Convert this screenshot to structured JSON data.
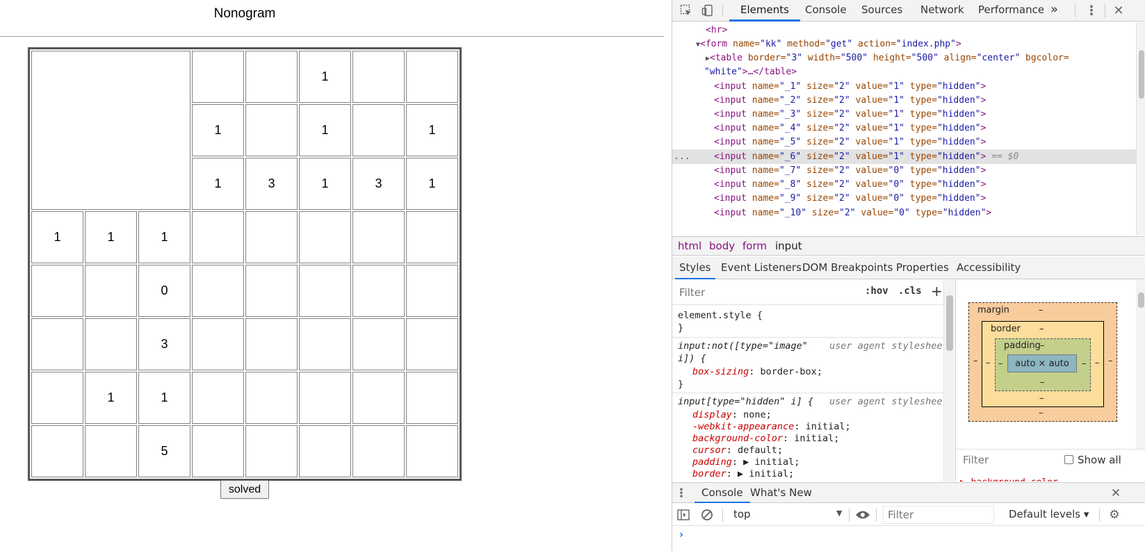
{
  "page": {
    "title": "Nonogram",
    "solved_label": "solved",
    "cells": [
      "",
      "",
      "1",
      "",
      "",
      "1",
      "",
      "1",
      "",
      "1",
      "1",
      "3",
      "1",
      "3",
      "1",
      "1",
      "1",
      "1",
      "",
      "",
      "",
      "",
      "",
      "",
      "",
      "0",
      "",
      "",
      "",
      "",
      "",
      "",
      "",
      "3",
      "",
      "",
      "",
      "",
      "",
      "",
      "1",
      "1",
      "",
      "",
      "",
      "",
      "",
      "",
      "",
      "5",
      "",
      "",
      "",
      "",
      ""
    ]
  },
  "devtools": {
    "main_tabs": [
      "Elements",
      "Console",
      "Sources",
      "Network",
      "Performance"
    ],
    "more_tabs": "»",
    "code": {
      "hr": "<hr>",
      "form_open": {
        "tag": "<form",
        "a1": " name=",
        "v1": "\"kk\"",
        "a2": " method=",
        "v2": "\"get\"",
        "a3": " action=",
        "v3": "\"index.php\"",
        "end": ">"
      },
      "table_line1": {
        "tag": "<table",
        "a1": " border=",
        "v1": "\"3\"",
        "a2": " width=",
        "v2": "\"500\"",
        "a3": " height=",
        "v3": "\"500\"",
        "a4": " align=",
        "v4": "\"center\"",
        "a5": " bgcolor="
      },
      "table_line2": {
        "v": "\"white\"",
        "rest": ">…</table>"
      },
      "inputs": [
        {
          "name": "\"_1\"",
          "value": "\"1\""
        },
        {
          "name": "\"_2\"",
          "value": "\"1\""
        },
        {
          "name": "\"_3\"",
          "value": "\"1\""
        },
        {
          "name": "\"_4\"",
          "value": "\"1\""
        },
        {
          "name": "\"_5\"",
          "value": "\"1\""
        },
        {
          "name": "\"_6\"",
          "value": "\"1\""
        },
        {
          "name": "\"_7\"",
          "value": "\"0\""
        },
        {
          "name": "\"_8\"",
          "value": "\"0\""
        },
        {
          "name": "\"_9\"",
          "value": "\"0\""
        },
        {
          "name": "\"_10\"",
          "value": "\"0\""
        }
      ],
      "input_tag": "<input",
      "name_attr": " name=",
      "size_attr": " size=",
      "size_val": "\"2\"",
      "value_attr": " value=",
      "type_attr": " type=",
      "type_val": "\"hidden\"",
      "close": ">",
      "selected_marker": "== $0",
      "ellipsis": "..."
    },
    "breadcrumbs": [
      "html",
      "body",
      "form",
      "input"
    ],
    "sub_tabs": [
      "Styles",
      "Event Listeners",
      "DOM Breakpoints",
      "Properties",
      "Accessibility"
    ],
    "styles": {
      "filter_placeholder": "Filter",
      "hov": ":hov",
      "cls": ".cls",
      "plus": "+",
      "element_style": "element.style {",
      "close_brace": "}",
      "rule2_selector_1": "input:not([type=\"image\"",
      "rule2_selector_2": "i]) {",
      "rule2_src": "user agent stylesheet",
      "rule2_prop": "box-sizing",
      "rule2_val": ": border-box;",
      "rule3_selector": "input[type=\"hidden\" i] {",
      "rule3_src": "user agent stylesheet",
      "rule3_props": [
        {
          "prop": "display",
          "val": ": none;"
        },
        {
          "prop": "-webkit-appearance",
          "val": ": initial;"
        },
        {
          "prop": "background-color",
          "val": ": initial;"
        },
        {
          "prop": "cursor",
          "val": ": default;"
        },
        {
          "prop": "padding",
          "val": ": ▶ initial;"
        },
        {
          "prop": "border",
          "val": ": ▶ initial;"
        }
      ]
    },
    "boxmodel": {
      "margin": "margin",
      "border": "border",
      "padding": "padding",
      "dash": "–",
      "content": "auto × auto",
      "filter_placeholder": "Filter",
      "show_all": "Show all",
      "next_prop": "▶ background-color"
    },
    "drawer_tabs": [
      "Console",
      "What's New"
    ],
    "console": {
      "context": "top",
      "filter_placeholder": "Filter",
      "levels": "Default levels ▾",
      "prompt": "›"
    }
  }
}
